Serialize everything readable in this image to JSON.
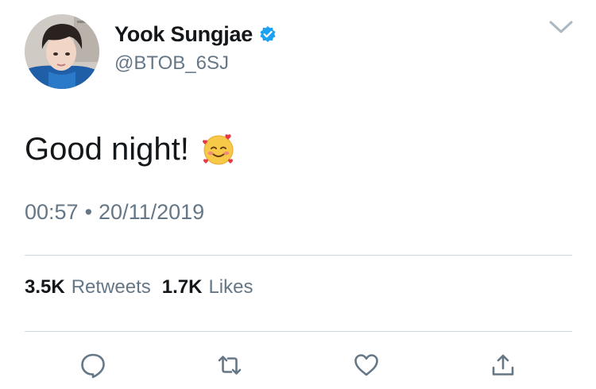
{
  "user": {
    "display_name": "Yook Sungjae",
    "handle": "@BTOB_6SJ",
    "verified": true
  },
  "tweet": {
    "text": "Good night!",
    "emoji": "smiling-face-with-hearts-icon",
    "time": "00:57",
    "separator": "•",
    "date": "20/11/2019"
  },
  "stats": {
    "retweets_count": "3.5K",
    "retweets_label": "Retweets",
    "likes_count": "1.7K",
    "likes_label": "Likes"
  },
  "actions": {
    "reply_icon": "reply-icon",
    "retweet_icon": "retweet-icon",
    "like_icon": "heart-icon",
    "share_icon": "share-icon"
  },
  "colors": {
    "primary_text": "#14171a",
    "secondary_text": "#657786",
    "divider": "#ccd6dd",
    "verified_blue": "#1da1f2"
  }
}
